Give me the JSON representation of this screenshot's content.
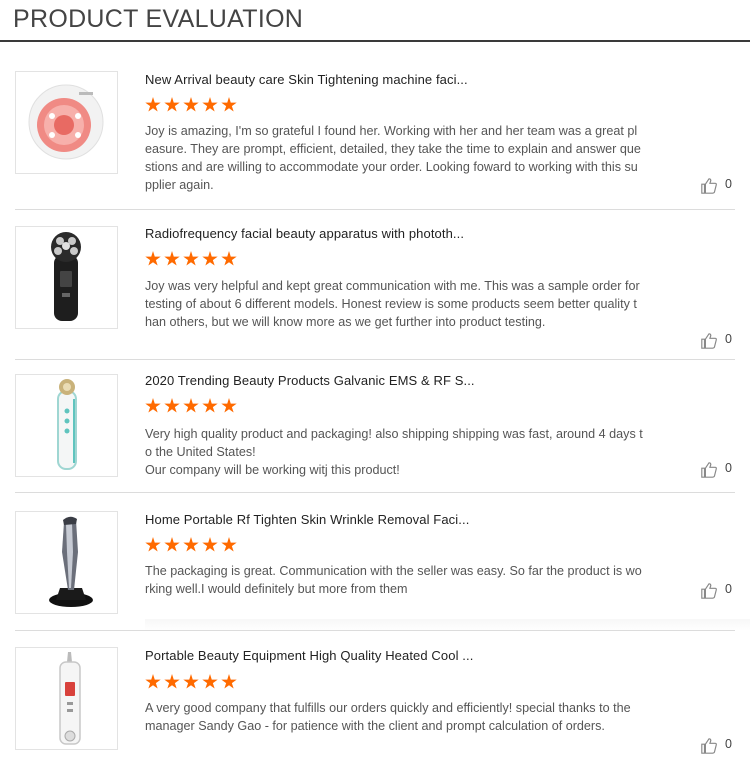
{
  "header": {
    "title": "PRODUCT EVALUATION"
  },
  "reviews": [
    {
      "title": "New Arrival beauty care Skin Tightening machine faci...",
      "rating": 5,
      "text": [
        "Joy is amazing, I'm so grateful I found her. Working with her and her team was a great pleasure. They are prompt, efficient, detailed, they take the time to explain and answer questions and are willing to accommodate your order. Looking foward to working with this supplier again."
      ],
      "likes": "0",
      "image_icon": "round-skin-tightening-device-icon"
    },
    {
      "title": "Radiofrequency facial beauty apparatus with phototh...",
      "rating": 5,
      "text": [
        "Joy was very helpful and kept great communication with me. This was a sample order for testing of about 6 different models. Honest review is some products seem better quality than others, but we will know more as we get further into product testing."
      ],
      "likes": "0",
      "image_icon": "black-rf-beauty-wand-icon"
    },
    {
      "title": "2020 Trending Beauty Products Galvanic EMS & RF S...",
      "rating": 5,
      "text": [
        "Very high quality product and packaging! also shipping shipping was fast, around 4 days to the United States!",
        "Our company will be working witj this product!"
      ],
      "likes": "0",
      "image_icon": "white-galvanic-wand-icon"
    },
    {
      "title": "Home Portable Rf Tighten Skin Wrinkle Removal Faci...",
      "rating": 5,
      "text": [
        "The packaging is great. Communication with the seller was easy. So far the product is working well.I would definitely but more from them"
      ],
      "likes": "0",
      "image_icon": "chrome-rf-wand-on-stand-icon"
    },
    {
      "title": "Portable Beauty Equipment High Quality Heated Cool ...",
      "rating": 5,
      "text": [
        "A very good company that fulfills our orders quickly and efficiently!  special thanks to the manager Sandy Gao - for patience with the client and prompt calculation of orders."
      ],
      "likes": "0",
      "image_icon": "white-pen-beauty-device-icon"
    }
  ],
  "colors": {
    "star": "#ff6a00",
    "header_rule": "#3a3a3a",
    "divider": "#dcdcdc"
  }
}
